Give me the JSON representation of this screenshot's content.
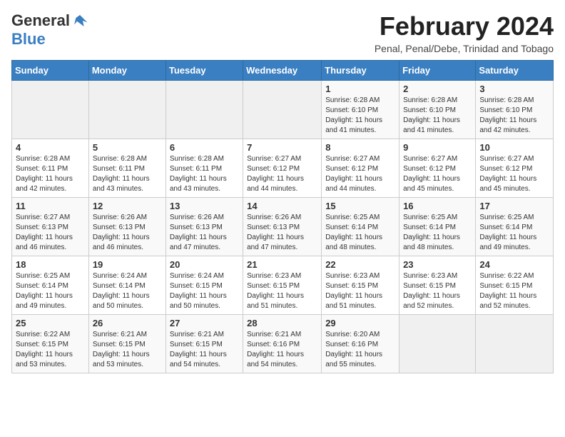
{
  "header": {
    "logo_general": "General",
    "logo_blue": "Blue",
    "month_title": "February 2024",
    "subtitle": "Penal, Penal/Debe, Trinidad and Tobago"
  },
  "weekdays": [
    "Sunday",
    "Monday",
    "Tuesday",
    "Wednesday",
    "Thursday",
    "Friday",
    "Saturday"
  ],
  "weeks": [
    [
      {
        "day": "",
        "info": ""
      },
      {
        "day": "",
        "info": ""
      },
      {
        "day": "",
        "info": ""
      },
      {
        "day": "",
        "info": ""
      },
      {
        "day": "1",
        "info": "Sunrise: 6:28 AM\nSunset: 6:10 PM\nDaylight: 11 hours and 41 minutes."
      },
      {
        "day": "2",
        "info": "Sunrise: 6:28 AM\nSunset: 6:10 PM\nDaylight: 11 hours and 41 minutes."
      },
      {
        "day": "3",
        "info": "Sunrise: 6:28 AM\nSunset: 6:10 PM\nDaylight: 11 hours and 42 minutes."
      }
    ],
    [
      {
        "day": "4",
        "info": "Sunrise: 6:28 AM\nSunset: 6:11 PM\nDaylight: 11 hours and 42 minutes."
      },
      {
        "day": "5",
        "info": "Sunrise: 6:28 AM\nSunset: 6:11 PM\nDaylight: 11 hours and 43 minutes."
      },
      {
        "day": "6",
        "info": "Sunrise: 6:28 AM\nSunset: 6:11 PM\nDaylight: 11 hours and 43 minutes."
      },
      {
        "day": "7",
        "info": "Sunrise: 6:27 AM\nSunset: 6:12 PM\nDaylight: 11 hours and 44 minutes."
      },
      {
        "day": "8",
        "info": "Sunrise: 6:27 AM\nSunset: 6:12 PM\nDaylight: 11 hours and 44 minutes."
      },
      {
        "day": "9",
        "info": "Sunrise: 6:27 AM\nSunset: 6:12 PM\nDaylight: 11 hours and 45 minutes."
      },
      {
        "day": "10",
        "info": "Sunrise: 6:27 AM\nSunset: 6:12 PM\nDaylight: 11 hours and 45 minutes."
      }
    ],
    [
      {
        "day": "11",
        "info": "Sunrise: 6:27 AM\nSunset: 6:13 PM\nDaylight: 11 hours and 46 minutes."
      },
      {
        "day": "12",
        "info": "Sunrise: 6:26 AM\nSunset: 6:13 PM\nDaylight: 11 hours and 46 minutes."
      },
      {
        "day": "13",
        "info": "Sunrise: 6:26 AM\nSunset: 6:13 PM\nDaylight: 11 hours and 47 minutes."
      },
      {
        "day": "14",
        "info": "Sunrise: 6:26 AM\nSunset: 6:13 PM\nDaylight: 11 hours and 47 minutes."
      },
      {
        "day": "15",
        "info": "Sunrise: 6:25 AM\nSunset: 6:14 PM\nDaylight: 11 hours and 48 minutes."
      },
      {
        "day": "16",
        "info": "Sunrise: 6:25 AM\nSunset: 6:14 PM\nDaylight: 11 hours and 48 minutes."
      },
      {
        "day": "17",
        "info": "Sunrise: 6:25 AM\nSunset: 6:14 PM\nDaylight: 11 hours and 49 minutes."
      }
    ],
    [
      {
        "day": "18",
        "info": "Sunrise: 6:25 AM\nSunset: 6:14 PM\nDaylight: 11 hours and 49 minutes."
      },
      {
        "day": "19",
        "info": "Sunrise: 6:24 AM\nSunset: 6:14 PM\nDaylight: 11 hours and 50 minutes."
      },
      {
        "day": "20",
        "info": "Sunrise: 6:24 AM\nSunset: 6:15 PM\nDaylight: 11 hours and 50 minutes."
      },
      {
        "day": "21",
        "info": "Sunrise: 6:23 AM\nSunset: 6:15 PM\nDaylight: 11 hours and 51 minutes."
      },
      {
        "day": "22",
        "info": "Sunrise: 6:23 AM\nSunset: 6:15 PM\nDaylight: 11 hours and 51 minutes."
      },
      {
        "day": "23",
        "info": "Sunrise: 6:23 AM\nSunset: 6:15 PM\nDaylight: 11 hours and 52 minutes."
      },
      {
        "day": "24",
        "info": "Sunrise: 6:22 AM\nSunset: 6:15 PM\nDaylight: 11 hours and 52 minutes."
      }
    ],
    [
      {
        "day": "25",
        "info": "Sunrise: 6:22 AM\nSunset: 6:15 PM\nDaylight: 11 hours and 53 minutes."
      },
      {
        "day": "26",
        "info": "Sunrise: 6:21 AM\nSunset: 6:15 PM\nDaylight: 11 hours and 53 minutes."
      },
      {
        "day": "27",
        "info": "Sunrise: 6:21 AM\nSunset: 6:15 PM\nDaylight: 11 hours and 54 minutes."
      },
      {
        "day": "28",
        "info": "Sunrise: 6:21 AM\nSunset: 6:16 PM\nDaylight: 11 hours and 54 minutes."
      },
      {
        "day": "29",
        "info": "Sunrise: 6:20 AM\nSunset: 6:16 PM\nDaylight: 11 hours and 55 minutes."
      },
      {
        "day": "",
        "info": ""
      },
      {
        "day": "",
        "info": ""
      }
    ]
  ]
}
